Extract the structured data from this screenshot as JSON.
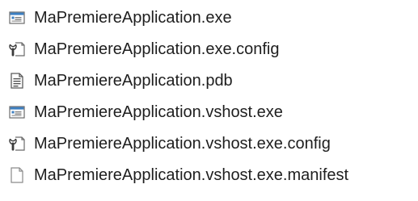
{
  "files": [
    {
      "name": "MaPremiereApplication.exe",
      "icon": "exe-window-icon"
    },
    {
      "name": "MaPremiereApplication.exe.config",
      "icon": "config-wrench-icon"
    },
    {
      "name": "MaPremiereApplication.pdb",
      "icon": "text-document-icon"
    },
    {
      "name": "MaPremiereApplication.vshost.exe",
      "icon": "exe-window-icon"
    },
    {
      "name": "MaPremiereApplication.vshost.exe.config",
      "icon": "config-wrench-icon"
    },
    {
      "name": "MaPremiereApplication.vshost.exe.manifest",
      "icon": "blank-file-icon"
    }
  ],
  "colors": {
    "text": "#1e1e1e",
    "exe_title_bar": "#3c7fc1",
    "icon_outline": "#6b6b6b"
  }
}
